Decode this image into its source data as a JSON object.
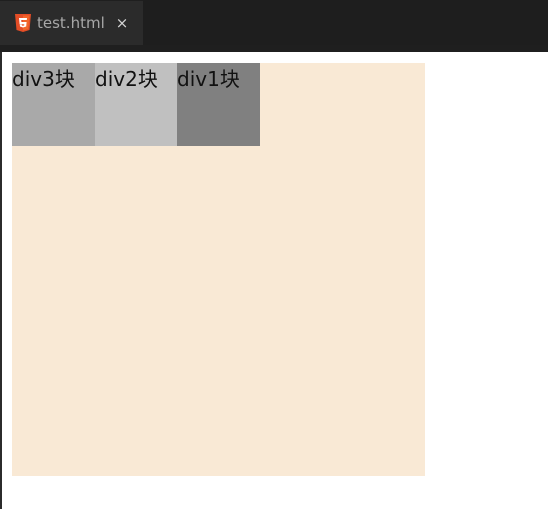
{
  "tab": {
    "label": "test.html",
    "close_label": "×"
  },
  "boxes": [
    {
      "label": "div3块",
      "color": "#a9a9a9"
    },
    {
      "label": "div2块",
      "color": "#c0c0c0"
    },
    {
      "label": "div1块",
      "color": "#808080"
    }
  ],
  "colors": {
    "container_bg": "#f9e9d5",
    "tab_bar_bg": "#1e1e1e",
    "tab_bg": "#2b2b2b",
    "html5_icon_orange": "#e44d26"
  },
  "icons": {
    "file_icon": "html5-icon",
    "close_icon": "close-icon"
  }
}
